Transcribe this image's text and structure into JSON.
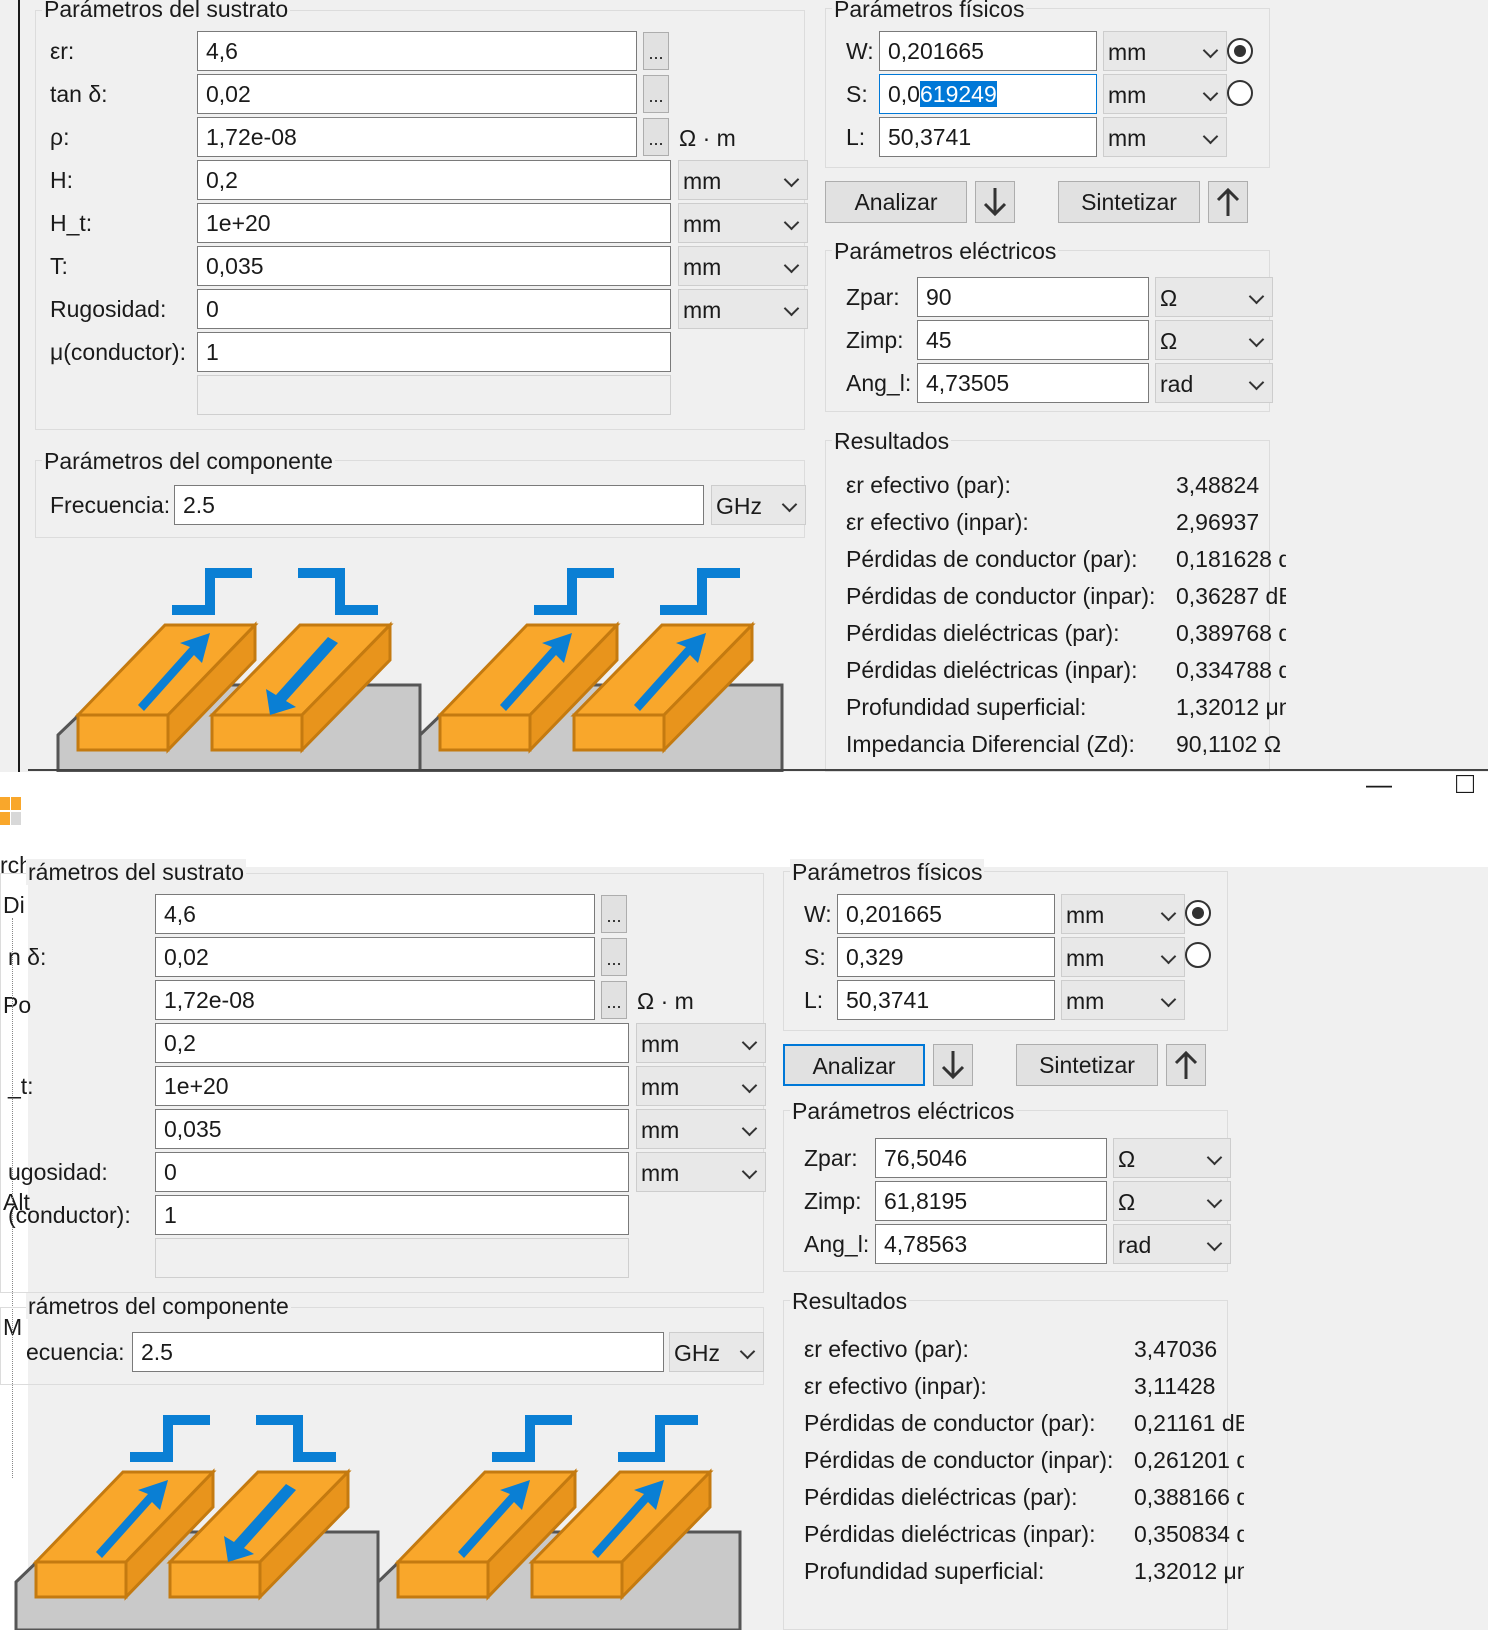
{
  "top": {
    "substrate": {
      "title": "Parámetros del sustrato",
      "rows": [
        {
          "label": "εr:",
          "value": "4,6",
          "dots": "..."
        },
        {
          "label": "tan δ:",
          "value": "0,02",
          "dots": "..."
        },
        {
          "label": "ρ:",
          "value": "1,72e-08",
          "dots": "...",
          "unit_text": "Ω · m"
        },
        {
          "label": "H:",
          "value": "0,2",
          "unit": "mm"
        },
        {
          "label": "H_t:",
          "value": "1e+20",
          "unit": "mm"
        },
        {
          "label": "T:",
          "value": "0,035",
          "unit": "mm"
        },
        {
          "label": "Rugosidad:",
          "value": "0",
          "unit": "mm"
        },
        {
          "label": "μ(conductor):",
          "value": "1"
        }
      ]
    },
    "component": {
      "title": "Parámetros del componente",
      "freq_label": "Frecuencia:",
      "freq_value": "2.5",
      "freq_unit": "GHz"
    },
    "physical": {
      "title": "Parámetros físicos",
      "rows": [
        {
          "label": "W:",
          "value": "0,201665",
          "unit": "mm"
        },
        {
          "label": "S:",
          "value_a": "0,0",
          "value_b": "619249",
          "unit": "mm"
        },
        {
          "label": "L:",
          "value": "50,3741",
          "unit": "mm"
        }
      ]
    },
    "buttons": {
      "analyze": "Analizar",
      "synthesize": "Sintetizar"
    },
    "electrical": {
      "title": "Parámetros eléctricos",
      "rows": [
        {
          "label": "Zpar:",
          "value": "90",
          "unit": "Ω"
        },
        {
          "label": "Zimp:",
          "value": "45",
          "unit": "Ω"
        },
        {
          "label": "Ang_l:",
          "value": "4,73505",
          "unit": "rad"
        }
      ]
    },
    "results": {
      "title": "Resultados",
      "rows": [
        {
          "label": "εr efectivo (par):",
          "value": "3,48824"
        },
        {
          "label": "εr efectivo (inpar):",
          "value": "2,96937"
        },
        {
          "label": "Pérdidas de conductor (par):",
          "value": "0,181628 d"
        },
        {
          "label": "Pérdidas de conductor (inpar):",
          "value": "0,36287 dB"
        },
        {
          "label": "Pérdidas dieléctricas (par):",
          "value": "0,389768 d"
        },
        {
          "label": "Pérdidas dieléctricas (inpar):",
          "value": "0,334788 d"
        },
        {
          "label": "Profundidad superficial:",
          "value": "1,32012 μm"
        },
        {
          "label": "Impedancia Diferencial (Zd):",
          "value": "90,1102 Ω"
        }
      ]
    }
  },
  "bottom": {
    "window": {
      "minimize": "—",
      "maximize": "□"
    },
    "substrate": {
      "title": "rámetros del sustrato",
      "rows": [
        {
          "label": "",
          "value": "4,6",
          "dots": "..."
        },
        {
          "label": "n δ:",
          "value": "0,02",
          "dots": "..."
        },
        {
          "label": "",
          "value": "1,72e-08",
          "dots": "...",
          "unit_text": "Ω · m"
        },
        {
          "label": "",
          "value": "0,2",
          "unit": "mm"
        },
        {
          "label": "_t:",
          "value": "1e+20",
          "unit": "mm"
        },
        {
          "label": "",
          "value": "0,035",
          "unit": "mm"
        },
        {
          "label": "ugosidad:",
          "value": "0",
          "unit": "mm"
        },
        {
          "label": "(conductor):",
          "value": "1"
        }
      ]
    },
    "component": {
      "title": "rámetros del componente",
      "freq_label": "ecuencia:",
      "freq_value": "2.5",
      "freq_unit": "GHz"
    },
    "physical": {
      "title": "Parámetros físicos",
      "rows": [
        {
          "label": "W:",
          "value": "0,201665",
          "unit": "mm"
        },
        {
          "label": "S:",
          "value": "0,329",
          "unit": "mm"
        },
        {
          "label": "L:",
          "value": "50,3741",
          "unit": "mm"
        }
      ]
    },
    "buttons": {
      "analyze": "Analizar",
      "synthesize": "Sintetizar"
    },
    "electrical": {
      "title": "Parámetros eléctricos",
      "rows": [
        {
          "label": "Zpar:",
          "value": "76,5046",
          "unit": "Ω"
        },
        {
          "label": "Zimp:",
          "value": "61,8195",
          "unit": "Ω"
        },
        {
          "label": "Ang_l:",
          "value": "4,78563",
          "unit": "rad"
        }
      ]
    },
    "results": {
      "title": "Resultados",
      "rows": [
        {
          "label": "εr efectivo (par):",
          "value": "3,47036"
        },
        {
          "label": "εr efectivo (inpar):",
          "value": "3,11428"
        },
        {
          "label": "Pérdidas de conductor (par):",
          "value": "0,21161 dB"
        },
        {
          "label": "Pérdidas de conductor (inpar):",
          "value": "0,261201 d"
        },
        {
          "label": "Pérdidas dieléctricas (par):",
          "value": "0,388166 d"
        },
        {
          "label": "Pérdidas dieléctricas (inpar):",
          "value": "0,350834 d"
        },
        {
          "label": "Profundidad superficial:",
          "value": "1,32012 μm"
        }
      ]
    },
    "sidebar": {
      "fragments": [
        "rch",
        "Di",
        "Po",
        "Alt",
        "M"
      ]
    }
  },
  "colors": {
    "strip": "#f9a72b",
    "strip_edge": "#c47a10",
    "arrow": "#0a7fd4",
    "substrate": "#c9c9c9"
  }
}
